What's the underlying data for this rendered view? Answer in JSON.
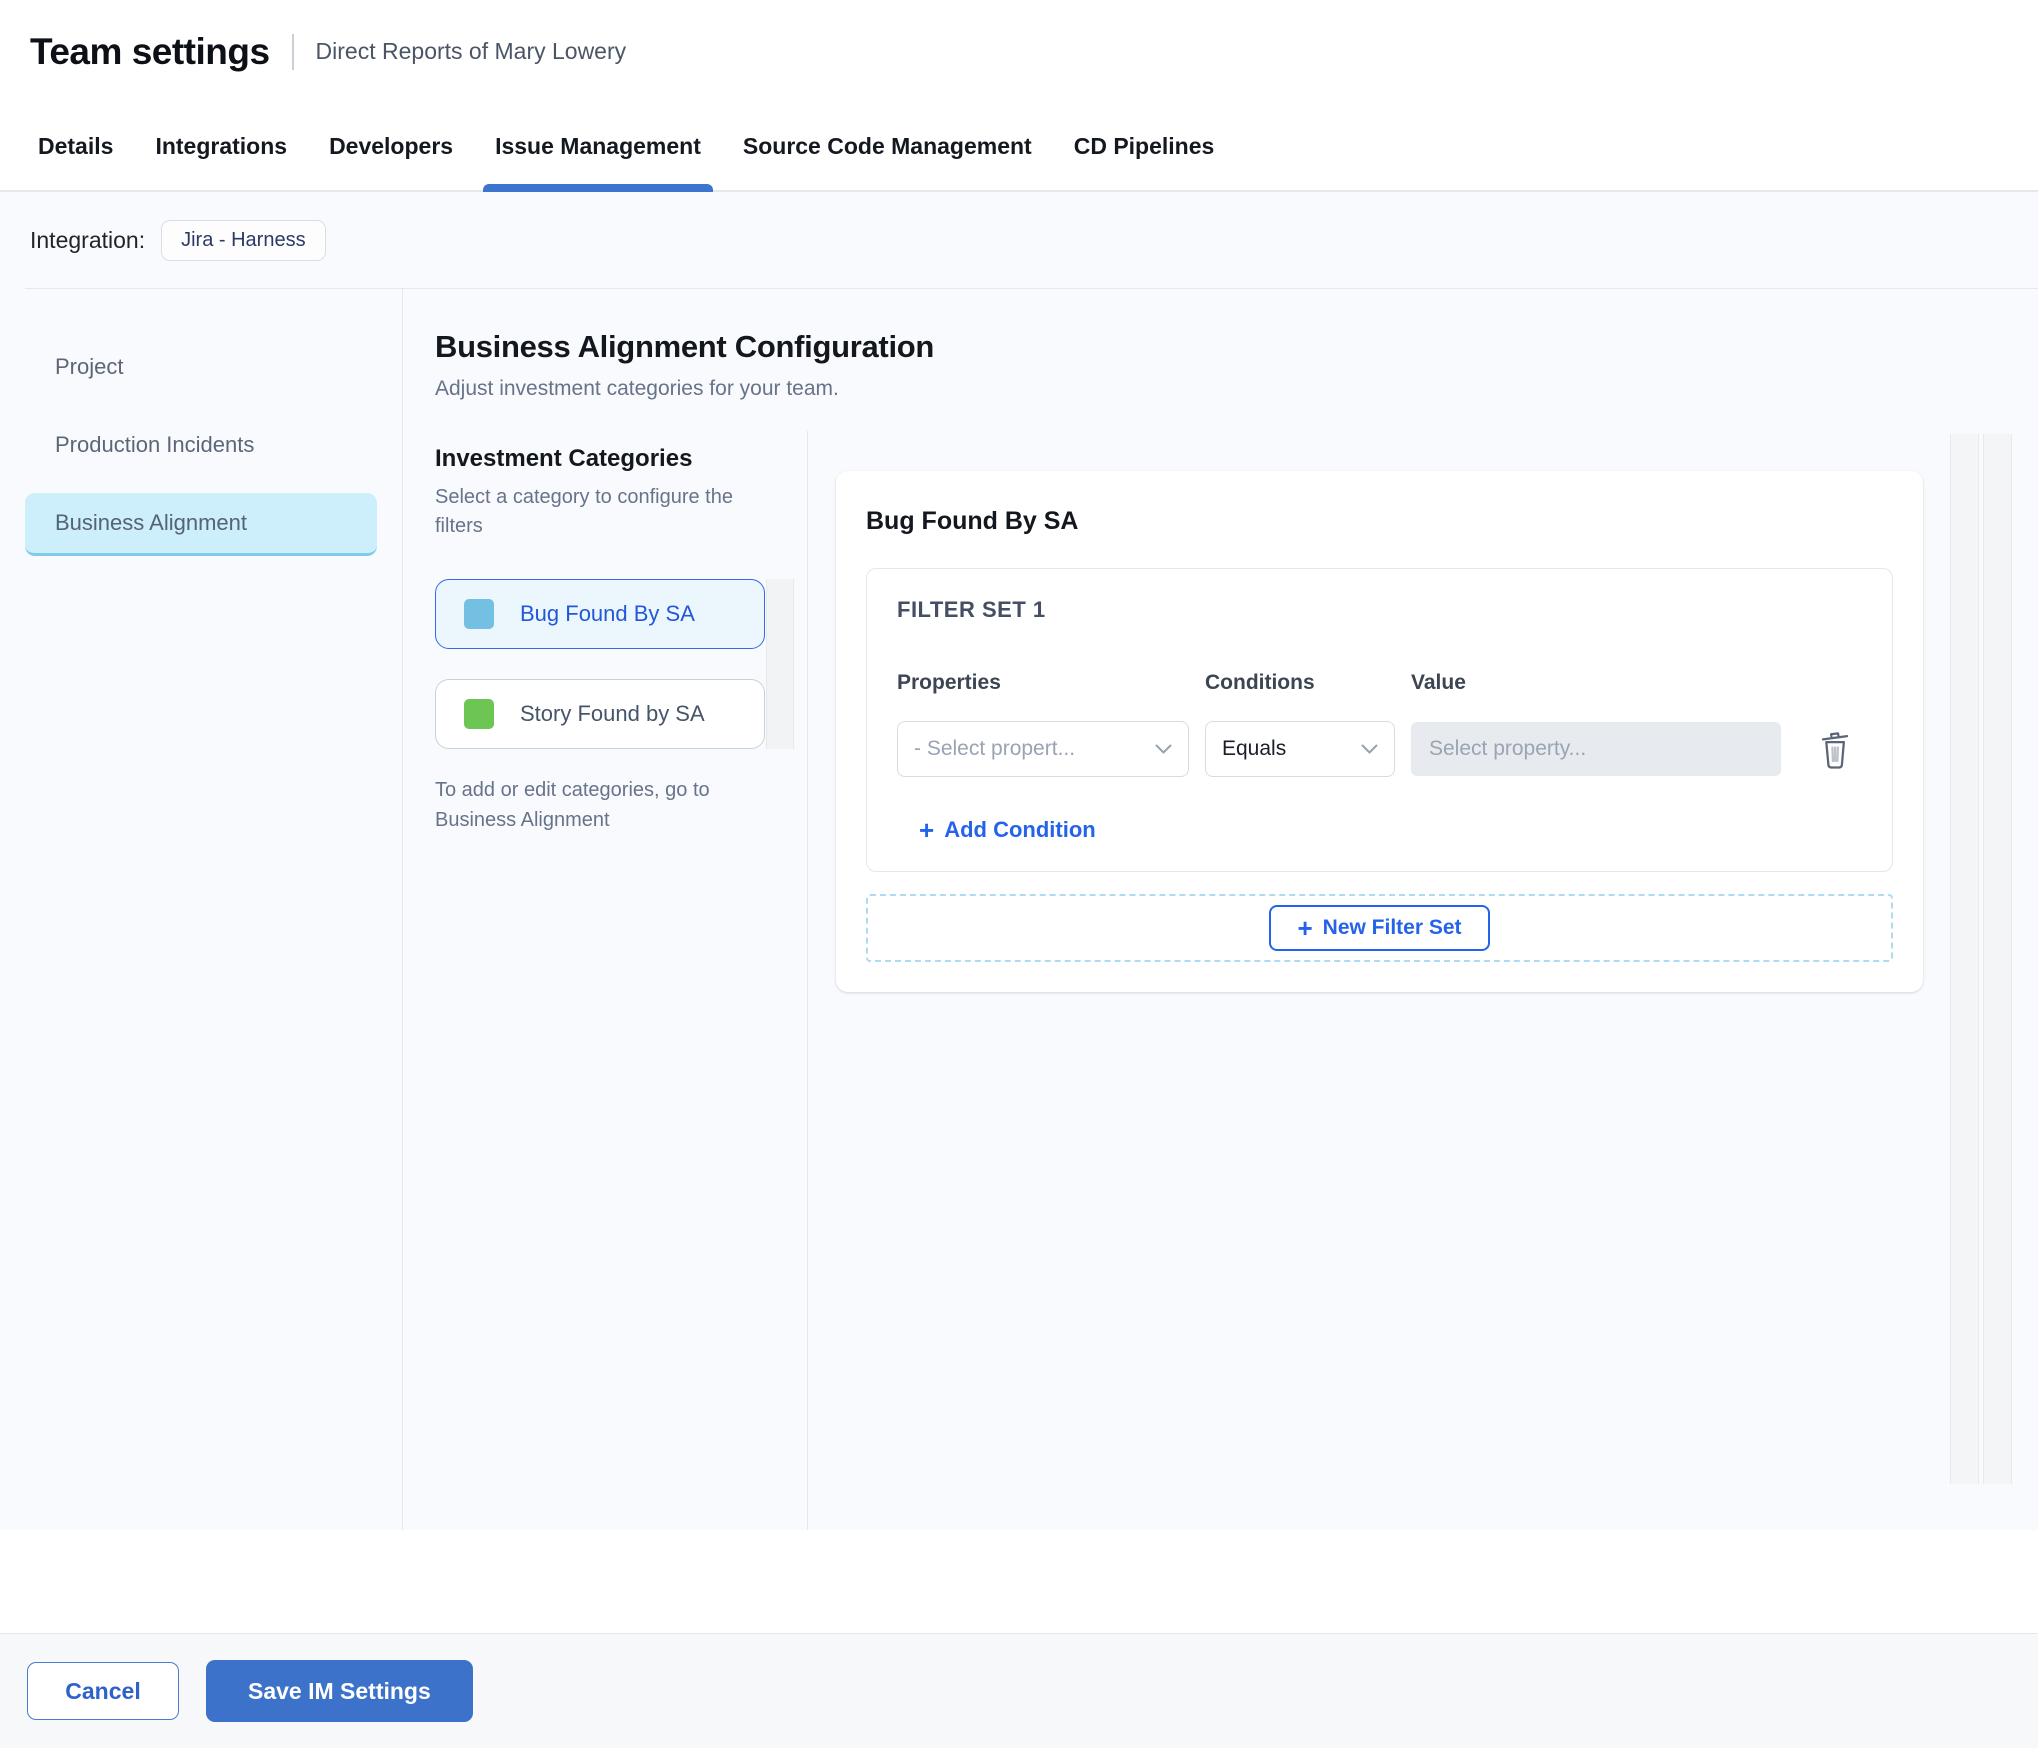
{
  "page": {
    "title": "Team settings",
    "subtitle": "Direct Reports of Mary Lowery"
  },
  "tabs": {
    "items": [
      {
        "label": "Details"
      },
      {
        "label": "Integrations"
      },
      {
        "label": "Developers"
      },
      {
        "label": "Issue Management"
      },
      {
        "label": "Source Code Management"
      },
      {
        "label": "CD Pipelines"
      }
    ]
  },
  "integration": {
    "label": "Integration:",
    "value": "Jira - Harness"
  },
  "sidebar": {
    "items": [
      {
        "label": "Project"
      },
      {
        "label": "Production Incidents"
      },
      {
        "label": "Business Alignment"
      }
    ]
  },
  "config": {
    "title": "Business Alignment Configuration",
    "subtitle": "Adjust investment categories for your team.",
    "categories": {
      "heading": "Investment Categories",
      "description": "Select a category to configure the filters",
      "items": [
        {
          "label": "Bug Found By SA",
          "color": "#74c0e2"
        },
        {
          "label": "Story Found by SA",
          "color": "#6dc653"
        }
      ],
      "note": "To add or edit categories, go to Business Alignment"
    },
    "panel": {
      "title": "Bug Found By SA",
      "filter_set": {
        "title": "FILTER SET 1",
        "columns": [
          "Properties",
          "Conditions",
          "Value"
        ],
        "property_placeholder": "- Select propert...",
        "condition_value": "Equals",
        "value_placeholder": "Select property...",
        "add_condition_label": "Add Condition"
      },
      "new_filter_set_label": "New Filter Set"
    }
  },
  "footer": {
    "cancel_label": "Cancel",
    "save_label": "Save IM Settings"
  },
  "icons": {
    "plus": "+"
  },
  "colors": {
    "primary_blue": "#3c72c9",
    "link_blue": "#2563eb",
    "active_tab_underline": "#3d74d0",
    "selected_sidebar_bg": "#cdeefb",
    "category_bug_swatch": "#74c0e2",
    "category_story_swatch": "#6dc653"
  }
}
